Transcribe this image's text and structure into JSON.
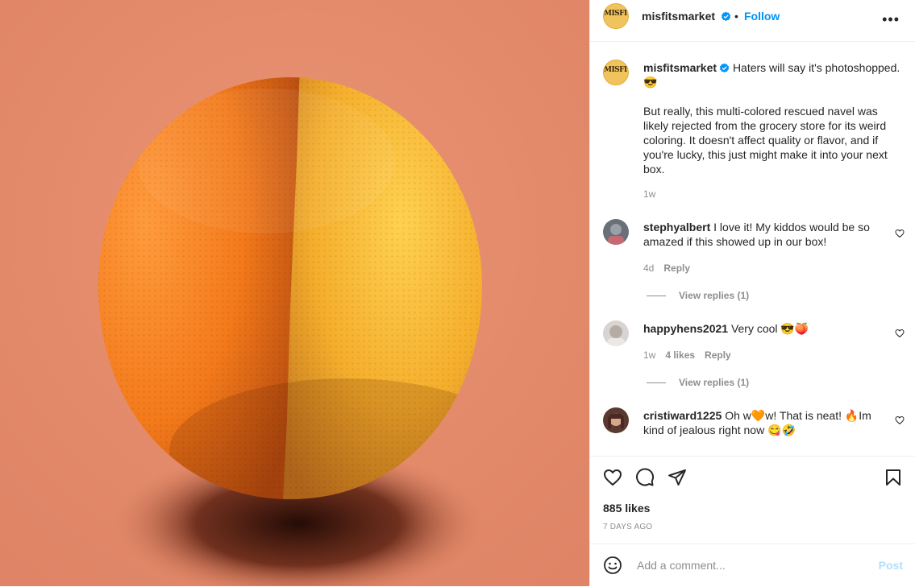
{
  "post": {
    "username": "misfitsmarket",
    "follow_label": "Follow",
    "separator": "•",
    "more_label": "•••",
    "avatar_text": "MISFITS",
    "caption_line1": "Haters will say it's photoshopped. 😎",
    "caption_line2": "But really, this multi-colored rescued navel was likely rejected from the grocery store for its weird coloring. It doesn't affect quality or flavor, and if you're lucky, this just might make it into your next box.",
    "caption_time": "1w"
  },
  "comments": [
    {
      "username": "stephyalbert",
      "text": "I love it! My kiddos would be so amazed if this showed up in our box!",
      "time": "4d",
      "likes": "",
      "reply": "Reply",
      "view_replies": "View replies (1)"
    },
    {
      "username": "happyhens2021",
      "text": "Very cool 😎🍑",
      "time": "1w",
      "likes": "4 likes",
      "reply": "Reply",
      "view_replies": "View replies (1)"
    },
    {
      "username": "cristiward1225",
      "text": "Oh w🧡w! That is neat! 🔥Im kind of jealous right now 😋🤣",
      "time": "",
      "likes": "",
      "reply": "",
      "view_replies": ""
    }
  ],
  "footer": {
    "likes": "885 likes",
    "date": "7 DAYS AGO",
    "comment_placeholder": "Add a comment...",
    "post_label": "Post"
  },
  "icons": {
    "like": "heart-icon",
    "comment": "comment-icon",
    "share": "paper-plane-icon",
    "save": "bookmark-icon",
    "emoji": "smiley-icon",
    "verified": "verified-badge-icon"
  },
  "colors": {
    "accent": "#0095f6",
    "post_disabled": "#b2dffc",
    "photo_background": "#e4896a",
    "muted_text": "#8e8e8e"
  }
}
